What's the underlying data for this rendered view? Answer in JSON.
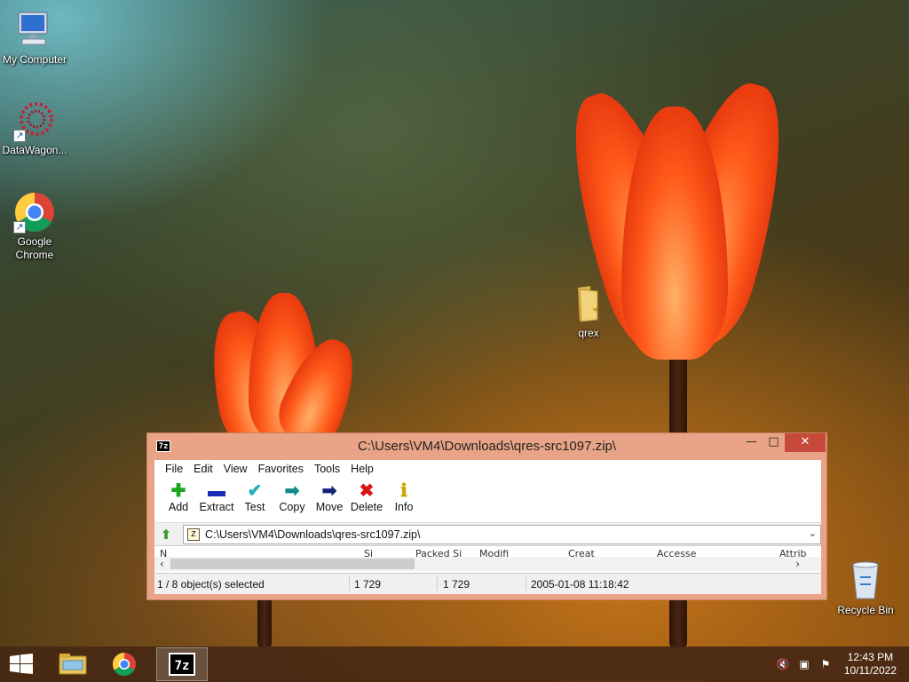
{
  "desktop": {
    "icons": [
      {
        "label": "My Computer",
        "icon": "computer-icon"
      },
      {
        "label": "DataWagon...",
        "icon": "datawagon-icon"
      },
      {
        "label": "Google Chrome",
        "icon": "chrome-icon"
      },
      {
        "label": "qrex",
        "icon": "folder-icon"
      },
      {
        "label": "Recycle Bin",
        "icon": "recycle-bin-icon"
      }
    ]
  },
  "window": {
    "icon_text": "7z",
    "title": "C:\\Users\\VM4\\Downloads\\qres-src1097.zip\\",
    "controls": {
      "minimize": "—",
      "maximize": "□",
      "close": "✕"
    },
    "menu": [
      "File",
      "Edit",
      "View",
      "Favorites",
      "Tools",
      "Help"
    ],
    "toolbar": [
      {
        "label": "Add",
        "icon": "add-icon",
        "glyph": "✚",
        "color": "#1aa51a"
      },
      {
        "label": "Extract",
        "icon": "extract-icon",
        "glyph": "▬",
        "color": "#1b2fb5"
      },
      {
        "label": "Test",
        "icon": "test-icon",
        "glyph": "✔",
        "color": "#22b0b8"
      },
      {
        "label": "Copy",
        "icon": "copy-icon",
        "glyph": "➡",
        "color": "#0e8a8a"
      },
      {
        "label": "Move",
        "icon": "move-icon",
        "glyph": "➡",
        "color": "#14227a"
      },
      {
        "label": "Delete",
        "icon": "delete-icon",
        "glyph": "✖",
        "color": "#d91414"
      },
      {
        "label": "Info",
        "icon": "info-icon",
        "glyph": "ℹ",
        "color": "#c7a800"
      }
    ],
    "address": "C:\\Users\\VM4\\Downloads\\qres-src1097.zip\\",
    "columns": [
      "N",
      "Si",
      "Packed Si",
      "Modifi",
      "Creat",
      "Accesse",
      "Attrib"
    ],
    "status": {
      "selection": "1 / 8 object(s) selected",
      "size": "1 729",
      "packed": "1 729",
      "modified": "2005-01-08 11:18:42"
    }
  },
  "taskbar": {
    "apps": [
      "file-explorer-icon",
      "chrome-icon",
      "7zip-icon"
    ],
    "active_app": "7zip-icon",
    "clock_time": "12:43 PM",
    "clock_date": "10/11/2022"
  }
}
